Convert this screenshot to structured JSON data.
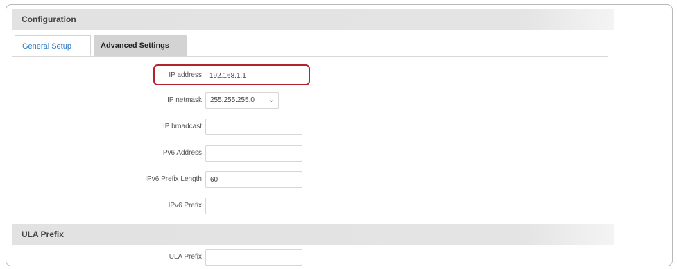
{
  "configuration": {
    "title": "Configuration",
    "tabs": [
      {
        "label": "General Setup"
      },
      {
        "label": "Advanced Settings"
      }
    ],
    "fields": {
      "ip_address": {
        "label": "IP address",
        "value": "192.168.1.1"
      },
      "ip_netmask": {
        "label": "IP netmask",
        "value": "255.255.255.0"
      },
      "ip_broadcast": {
        "label": "IP broadcast",
        "value": ""
      },
      "ipv6_address": {
        "label": "IPv6 Address",
        "value": ""
      },
      "ipv6_prefix_length": {
        "label": "IPv6 Prefix Length",
        "value": "60"
      },
      "ipv6_prefix": {
        "label": "IPv6 Prefix",
        "value": ""
      }
    }
  },
  "ula": {
    "title": "ULA Prefix",
    "field": {
      "label": "ULA Prefix",
      "value": ""
    }
  },
  "colors": {
    "highlight": "#b5232f",
    "active_tab_text": "#2e7bc4"
  },
  "icons": {
    "netmask_dropdown": "chevron-down-icon"
  }
}
